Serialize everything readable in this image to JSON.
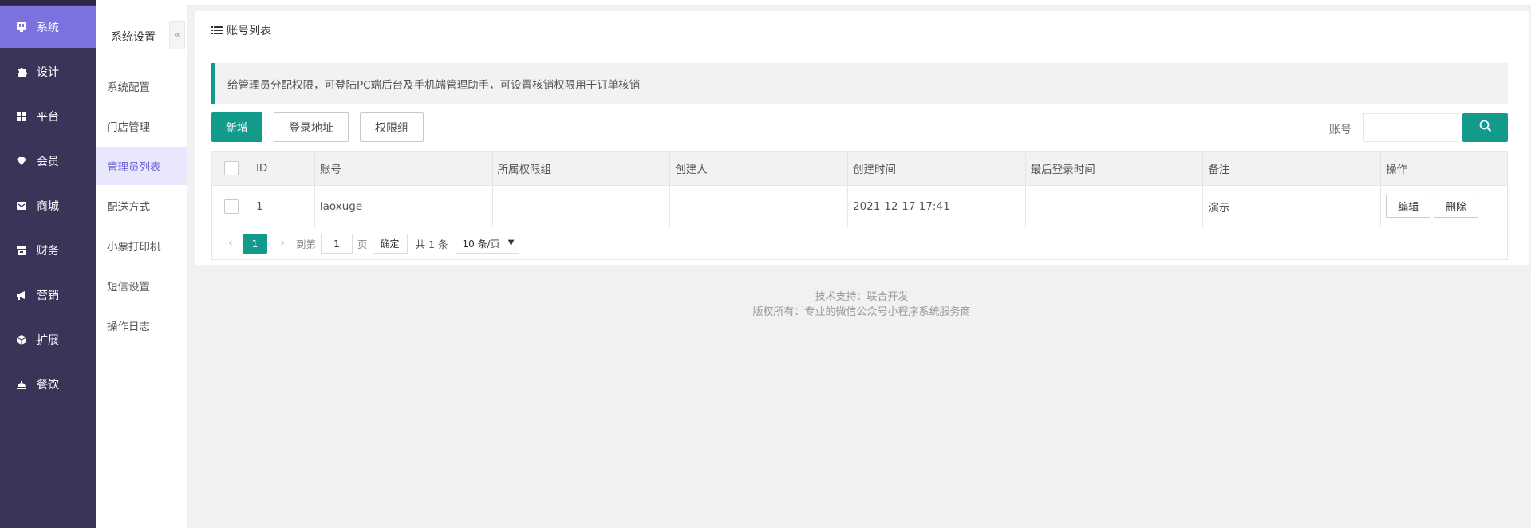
{
  "nav": {
    "items": [
      {
        "label": "系统",
        "icon": "tv-icon"
      },
      {
        "label": "设计",
        "icon": "puzzle-icon"
      },
      {
        "label": "平台",
        "icon": "grid-icon"
      },
      {
        "label": "会员",
        "icon": "diamond-icon"
      },
      {
        "label": "商城",
        "icon": "mail-icon"
      },
      {
        "label": "财务",
        "icon": "wallet-icon"
      },
      {
        "label": "营销",
        "icon": "megaphone-icon"
      },
      {
        "label": "扩展",
        "icon": "cube-icon"
      },
      {
        "label": "餐饮",
        "icon": "bell-icon"
      }
    ],
    "active_color": "#7b72e0",
    "bg_color": "#393559"
  },
  "submenu": {
    "title": "系统设置",
    "collapse_icon": "«",
    "items": [
      {
        "label": "系统配置"
      },
      {
        "label": "门店管理"
      },
      {
        "label": "管理员列表"
      },
      {
        "label": "配送方式"
      },
      {
        "label": "小票打印机"
      },
      {
        "label": "短信设置"
      },
      {
        "label": "操作日志"
      }
    ]
  },
  "main": {
    "title": "账号列表",
    "tip": "给管理员分配权限，可登陆PC端后台及手机端管理助手，可设置核销权限用于订单核销",
    "buttons": {
      "add": "新增",
      "login_url": "登录地址",
      "perm_group": "权限组"
    },
    "search": {
      "label": "账号",
      "value": ""
    },
    "accent_color": "#129a8a"
  },
  "table": {
    "headers": {
      "id": "ID",
      "account": "账号",
      "group": "所属权限组",
      "creator": "创建人",
      "created": "创建时间",
      "last_login": "最后登录时间",
      "note": "备注",
      "ops": "操作"
    },
    "rows": [
      {
        "id": "1",
        "account": "laoxuge",
        "group": "",
        "creator": "",
        "created": "2021-12-17 17:41",
        "last_login": "",
        "note": "演示",
        "edit": "编辑",
        "delete": "删除"
      }
    ]
  },
  "pager": {
    "prev": "‹",
    "next": "›",
    "current": "1",
    "goto_prefix": "到第",
    "goto_value": "1",
    "goto_suffix": "页",
    "confirm": "确定",
    "total": "共 1 条",
    "page_size": "10 条/页"
  },
  "footer": {
    "line1": "技术支持：联合开发",
    "line2": "版权所有：专业的微信公众号小程序系统服务商"
  }
}
